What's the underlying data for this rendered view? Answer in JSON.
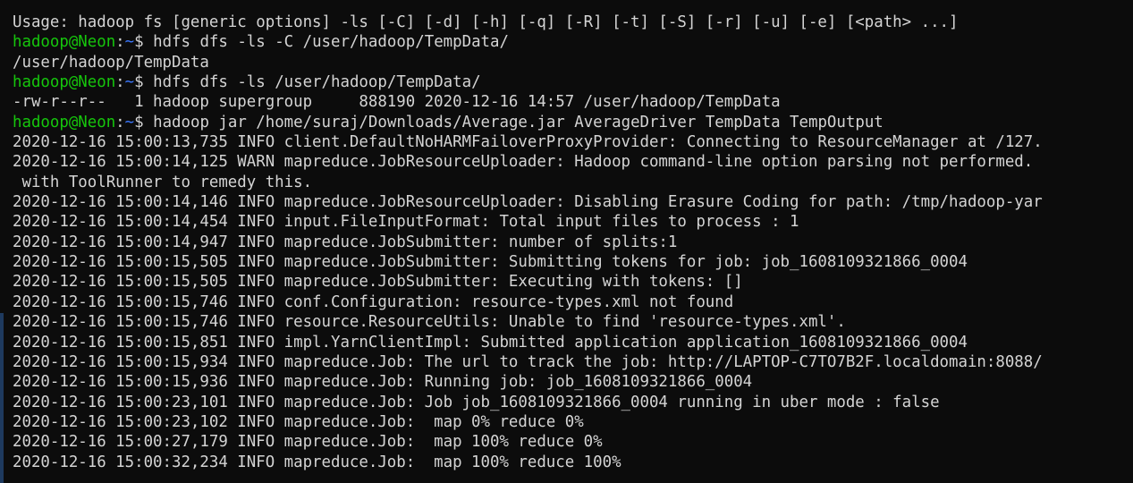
{
  "colors": {
    "background": "#0c0c0c",
    "foreground": "#d4d4d4",
    "prompt_user": "#16c60c",
    "prompt_path": "#3b78ff"
  },
  "terminal": {
    "lines": [
      {
        "type": "output",
        "text": "Usage: hadoop fs [generic options] -ls [-C] [-d] [-h] [-q] [-R] [-t] [-S] [-r] [-u] [-e] [<path> ...]"
      },
      {
        "type": "prompt",
        "user": "hadoop@Neon",
        "sep": ":",
        "path": "~",
        "symbol": "$ ",
        "command": "hdfs dfs -ls -C /user/hadoop/TempData/"
      },
      {
        "type": "output",
        "text": "/user/hadoop/TempData"
      },
      {
        "type": "prompt",
        "user": "hadoop@Neon",
        "sep": ":",
        "path": "~",
        "symbol": "$ ",
        "command": "hdfs dfs -ls /user/hadoop/TempData/"
      },
      {
        "type": "output",
        "text": "-rw-r--r--   1 hadoop supergroup     888190 2020-12-16 14:57 /user/hadoop/TempData"
      },
      {
        "type": "prompt",
        "user": "hadoop@Neon",
        "sep": ":",
        "path": "~",
        "symbol": "$ ",
        "command": "hadoop jar /home/suraj/Downloads/Average.jar AverageDriver TempData TempOutput"
      },
      {
        "type": "output",
        "text": "2020-12-16 15:00:13,735 INFO client.DefaultNoHARMFailoverProxyProvider: Connecting to ResourceManager at /127."
      },
      {
        "type": "output",
        "text": "2020-12-16 15:00:14,125 WARN mapreduce.JobResourceUploader: Hadoop command-line option parsing not performed."
      },
      {
        "type": "output",
        "text": " with ToolRunner to remedy this."
      },
      {
        "type": "output",
        "text": "2020-12-16 15:00:14,146 INFO mapreduce.JobResourceUploader: Disabling Erasure Coding for path: /tmp/hadoop-yar"
      },
      {
        "type": "output",
        "text": "2020-12-16 15:00:14,454 INFO input.FileInputFormat: Total input files to process : 1"
      },
      {
        "type": "output",
        "text": "2020-12-16 15:00:14,947 INFO mapreduce.JobSubmitter: number of splits:1"
      },
      {
        "type": "output",
        "text": "2020-12-16 15:00:15,505 INFO mapreduce.JobSubmitter: Submitting tokens for job: job_1608109321866_0004"
      },
      {
        "type": "output",
        "text": "2020-12-16 15:00:15,505 INFO mapreduce.JobSubmitter: Executing with tokens: []"
      },
      {
        "type": "output",
        "text": "2020-12-16 15:00:15,746 INFO conf.Configuration: resource-types.xml not found"
      },
      {
        "type": "output",
        "text": "2020-12-16 15:00:15,746 INFO resource.ResourceUtils: Unable to find 'resource-types.xml'."
      },
      {
        "type": "output",
        "text": "2020-12-16 15:00:15,851 INFO impl.YarnClientImpl: Submitted application application_1608109321866_0004"
      },
      {
        "type": "output",
        "text": "2020-12-16 15:00:15,934 INFO mapreduce.Job: The url to track the job: http://LAPTOP-C7TO7B2F.localdomain:8088/"
      },
      {
        "type": "output",
        "text": "2020-12-16 15:00:15,936 INFO mapreduce.Job: Running job: job_1608109321866_0004"
      },
      {
        "type": "output",
        "text": "2020-12-16 15:00:23,101 INFO mapreduce.Job: Job job_1608109321866_0004 running in uber mode : false"
      },
      {
        "type": "output",
        "text": "2020-12-16 15:00:23,102 INFO mapreduce.Job:  map 0% reduce 0%"
      },
      {
        "type": "output",
        "text": "2020-12-16 15:00:27,179 INFO mapreduce.Job:  map 100% reduce 0%"
      },
      {
        "type": "output",
        "text": "2020-12-16 15:00:32,234 INFO mapreduce.Job:  map 100% reduce 100%"
      }
    ]
  }
}
